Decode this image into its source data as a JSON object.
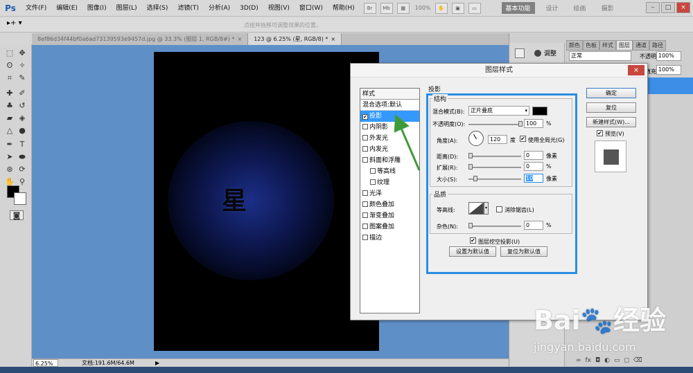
{
  "menubar": {
    "logo": "Ps",
    "items": [
      "文件(F)",
      "编辑(E)",
      "图像(I)",
      "图层(L)",
      "选择(S)",
      "滤镜(T)",
      "分析(A)",
      "3D(D)",
      "视图(V)",
      "窗口(W)",
      "帮助(H)"
    ],
    "icon_br": "Br",
    "icon_mb": "Mb",
    "zoom": "100%",
    "workspaces": [
      "基本功能",
      "设计",
      "绘画",
      "摄影"
    ],
    "win_controls": [
      "–",
      "□",
      "×"
    ]
  },
  "options": {
    "tool": "▸+ ▾",
    "hint": "点按并拖移可调整效果的位置。"
  },
  "tabs": [
    {
      "label": "8ef86d34f44bf0a6ad73139593e9457d.jpg @ 33.3% (图层 1, RGB/8#) *",
      "close": "×"
    },
    {
      "label": "123 @ 6.25% (星, RGB/8) *",
      "close": "×"
    }
  ],
  "canvas": {
    "glyph": "星"
  },
  "status": {
    "zoom": "6.25%",
    "doc_size": "文档:191.6M/64.6M",
    "arrow": "▶"
  },
  "right_panel": {
    "adjust": "调整",
    "tabs": [
      "颜色",
      "色板",
      "样式",
      "图层",
      "通道",
      "路径"
    ],
    "blend_mode": "正常",
    "opacity_label": "不透明度:",
    "opacity": "100%",
    "fill_label": "填充:",
    "fill": "100%",
    "bottom_icons": [
      "∞",
      "fx",
      "◘",
      "◐",
      "▭",
      "◻",
      "⌫"
    ]
  },
  "dialog": {
    "title": "图层样式",
    "close": "×",
    "styles_header": "样式",
    "styles": [
      {
        "label": "混合选项:默认",
        "checkbox": false,
        "sub": false,
        "selected": false,
        "check": ""
      },
      {
        "label": "投影",
        "checkbox": true,
        "sub": false,
        "selected": true,
        "check": "✔"
      },
      {
        "label": "内阴影",
        "checkbox": true,
        "sub": false,
        "selected": false,
        "check": ""
      },
      {
        "label": "外发光",
        "checkbox": true,
        "sub": false,
        "selected": false,
        "check": ""
      },
      {
        "label": "内发光",
        "checkbox": true,
        "sub": false,
        "selected": false,
        "check": ""
      },
      {
        "label": "斜面和浮雕",
        "checkbox": true,
        "sub": false,
        "selected": false,
        "check": ""
      },
      {
        "label": "等高线",
        "checkbox": true,
        "sub": true,
        "selected": false,
        "check": ""
      },
      {
        "label": "纹理",
        "checkbox": true,
        "sub": true,
        "selected": false,
        "check": ""
      },
      {
        "label": "光泽",
        "checkbox": true,
        "sub": false,
        "selected": false,
        "check": ""
      },
      {
        "label": "颜色叠加",
        "checkbox": true,
        "sub": false,
        "selected": false,
        "check": ""
      },
      {
        "label": "渐变叠加",
        "checkbox": true,
        "sub": false,
        "selected": false,
        "check": ""
      },
      {
        "label": "图案叠加",
        "checkbox": true,
        "sub": false,
        "selected": false,
        "check": ""
      },
      {
        "label": "描边",
        "checkbox": true,
        "sub": false,
        "selected": false,
        "check": ""
      }
    ],
    "section": "投影",
    "structure": "结构",
    "blend_mode_label": "混合模式(B):",
    "blend_mode": "正片叠底",
    "shadow_color": "#000000",
    "opacity_label": "不透明度(O):",
    "opacity": "100",
    "pct": "%",
    "angle_label": "角度(A):",
    "angle": "120",
    "degree": "度",
    "global_light": "使用全局光(G)",
    "global_light_checked": "✔",
    "distance_label": "距离(D):",
    "distance": "0",
    "px": "像素",
    "spread_label": "扩展(R):",
    "spread": "0",
    "size_label": "大小(S):",
    "size": "10",
    "quality": "品质",
    "contour_label": "等高线:",
    "anti_alias": "消除锯齿(L)",
    "noise_label": "杂色(N):",
    "noise": "0",
    "knockout": "图层挖空投影(U)",
    "knockout_checked": "✔",
    "make_default": "设置为默认值",
    "reset_default": "复位为默认值",
    "ok": "确定",
    "reset": "复位",
    "new_style": "新建样式(W)...",
    "preview": "预览(V)",
    "preview_checked": "✔"
  },
  "watermark": {
    "big": "Bai🐾经验",
    "small": "jingyan.baidu.com"
  }
}
